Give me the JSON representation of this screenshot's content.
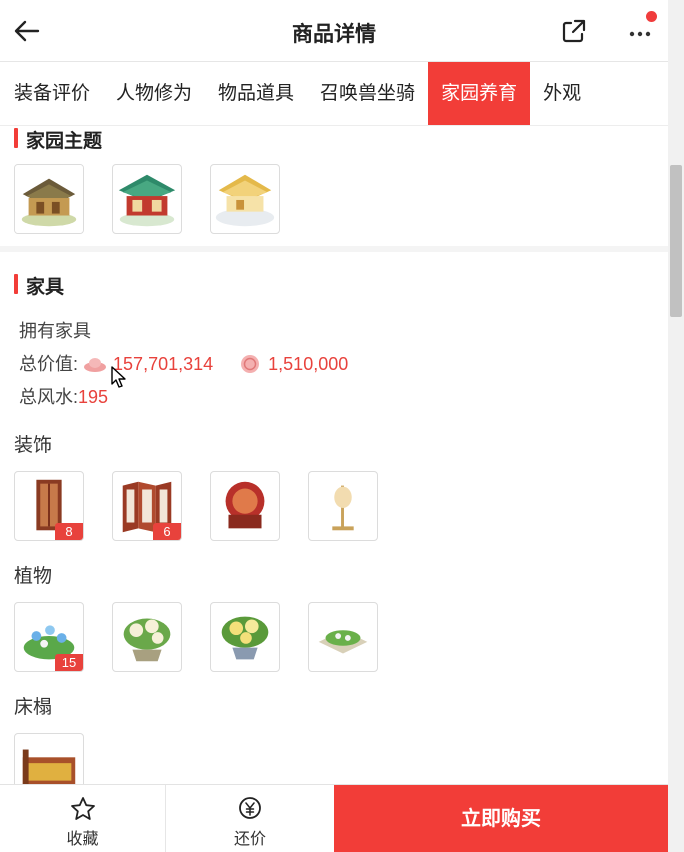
{
  "header": {
    "title": "商品详情"
  },
  "tabs": [
    {
      "label": "装备评价",
      "active": false
    },
    {
      "label": "人物修为",
      "active": false
    },
    {
      "label": "物品道具",
      "active": false
    },
    {
      "label": "召唤兽坐骑",
      "active": false
    },
    {
      "label": "家园养育",
      "active": true
    },
    {
      "label": "外观",
      "active": false
    }
  ],
  "home_theme": {
    "title": "家园主题",
    "items": [
      {
        "icon": "house-wood-icon"
      },
      {
        "icon": "house-jade-icon"
      },
      {
        "icon": "house-snow-icon"
      }
    ]
  },
  "furniture": {
    "title": "家具",
    "owned_label": "拥有家具",
    "total_value_label": "总价值:",
    "total_value_1": "157,701,314",
    "total_value_2": "1,510,000",
    "fengshui_label": "总风水:",
    "fengshui_value": "195",
    "categories": [
      {
        "name": "装饰",
        "items": [
          {
            "icon": "screen-door-icon",
            "count": "8"
          },
          {
            "icon": "folding-screen-icon",
            "count": "6"
          },
          {
            "icon": "red-chair-icon",
            "count": ""
          },
          {
            "icon": "lamp-icon",
            "count": ""
          }
        ]
      },
      {
        "name": "植物",
        "items": [
          {
            "icon": "blue-flower-bed-icon",
            "count": "15"
          },
          {
            "icon": "white-flower-pot-icon",
            "count": ""
          },
          {
            "icon": "yellow-flower-pot-icon",
            "count": ""
          },
          {
            "icon": "garden-planter-icon",
            "count": ""
          }
        ]
      },
      {
        "name": "床榻",
        "items": [
          {
            "icon": "bed-icon",
            "count": ""
          }
        ]
      }
    ]
  },
  "bottom": {
    "favorite_label": "收藏",
    "bargain_label": "还价",
    "buy_label": "立即购买"
  },
  "colors": {
    "accent": "#f23d38",
    "badge": "#e8423c"
  }
}
